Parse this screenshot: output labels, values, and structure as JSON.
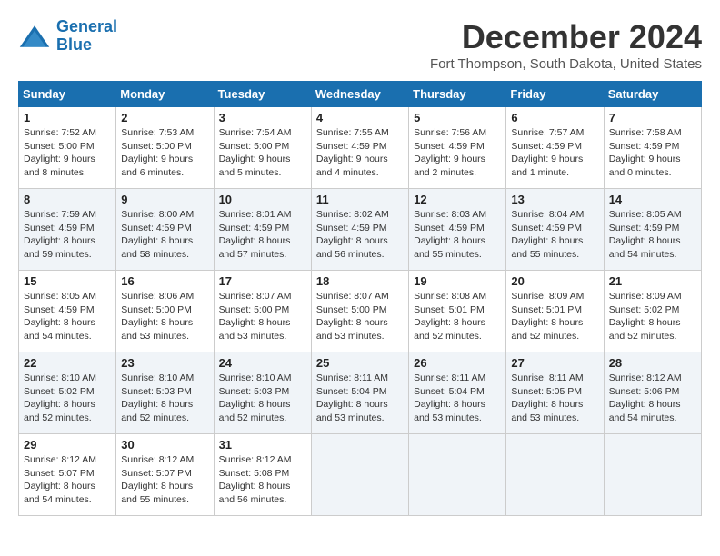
{
  "logo": {
    "line1": "General",
    "line2": "Blue"
  },
  "title": "December 2024",
  "location": "Fort Thompson, South Dakota, United States",
  "days_of_week": [
    "Sunday",
    "Monday",
    "Tuesday",
    "Wednesday",
    "Thursday",
    "Friday",
    "Saturday"
  ],
  "weeks": [
    [
      {
        "day": "1",
        "info": "Sunrise: 7:52 AM\nSunset: 5:00 PM\nDaylight: 9 hours\nand 8 minutes."
      },
      {
        "day": "2",
        "info": "Sunrise: 7:53 AM\nSunset: 5:00 PM\nDaylight: 9 hours\nand 6 minutes."
      },
      {
        "day": "3",
        "info": "Sunrise: 7:54 AM\nSunset: 5:00 PM\nDaylight: 9 hours\nand 5 minutes."
      },
      {
        "day": "4",
        "info": "Sunrise: 7:55 AM\nSunset: 4:59 PM\nDaylight: 9 hours\nand 4 minutes."
      },
      {
        "day": "5",
        "info": "Sunrise: 7:56 AM\nSunset: 4:59 PM\nDaylight: 9 hours\nand 2 minutes."
      },
      {
        "day": "6",
        "info": "Sunrise: 7:57 AM\nSunset: 4:59 PM\nDaylight: 9 hours\nand 1 minute."
      },
      {
        "day": "7",
        "info": "Sunrise: 7:58 AM\nSunset: 4:59 PM\nDaylight: 9 hours\nand 0 minutes."
      }
    ],
    [
      {
        "day": "8",
        "info": "Sunrise: 7:59 AM\nSunset: 4:59 PM\nDaylight: 8 hours\nand 59 minutes."
      },
      {
        "day": "9",
        "info": "Sunrise: 8:00 AM\nSunset: 4:59 PM\nDaylight: 8 hours\nand 58 minutes."
      },
      {
        "day": "10",
        "info": "Sunrise: 8:01 AM\nSunset: 4:59 PM\nDaylight: 8 hours\nand 57 minutes."
      },
      {
        "day": "11",
        "info": "Sunrise: 8:02 AM\nSunset: 4:59 PM\nDaylight: 8 hours\nand 56 minutes."
      },
      {
        "day": "12",
        "info": "Sunrise: 8:03 AM\nSunset: 4:59 PM\nDaylight: 8 hours\nand 55 minutes."
      },
      {
        "day": "13",
        "info": "Sunrise: 8:04 AM\nSunset: 4:59 PM\nDaylight: 8 hours\nand 55 minutes."
      },
      {
        "day": "14",
        "info": "Sunrise: 8:05 AM\nSunset: 4:59 PM\nDaylight: 8 hours\nand 54 minutes."
      }
    ],
    [
      {
        "day": "15",
        "info": "Sunrise: 8:05 AM\nSunset: 4:59 PM\nDaylight: 8 hours\nand 54 minutes."
      },
      {
        "day": "16",
        "info": "Sunrise: 8:06 AM\nSunset: 5:00 PM\nDaylight: 8 hours\nand 53 minutes."
      },
      {
        "day": "17",
        "info": "Sunrise: 8:07 AM\nSunset: 5:00 PM\nDaylight: 8 hours\nand 53 minutes."
      },
      {
        "day": "18",
        "info": "Sunrise: 8:07 AM\nSunset: 5:00 PM\nDaylight: 8 hours\nand 53 minutes."
      },
      {
        "day": "19",
        "info": "Sunrise: 8:08 AM\nSunset: 5:01 PM\nDaylight: 8 hours\nand 52 minutes."
      },
      {
        "day": "20",
        "info": "Sunrise: 8:09 AM\nSunset: 5:01 PM\nDaylight: 8 hours\nand 52 minutes."
      },
      {
        "day": "21",
        "info": "Sunrise: 8:09 AM\nSunset: 5:02 PM\nDaylight: 8 hours\nand 52 minutes."
      }
    ],
    [
      {
        "day": "22",
        "info": "Sunrise: 8:10 AM\nSunset: 5:02 PM\nDaylight: 8 hours\nand 52 minutes."
      },
      {
        "day": "23",
        "info": "Sunrise: 8:10 AM\nSunset: 5:03 PM\nDaylight: 8 hours\nand 52 minutes."
      },
      {
        "day": "24",
        "info": "Sunrise: 8:10 AM\nSunset: 5:03 PM\nDaylight: 8 hours\nand 52 minutes."
      },
      {
        "day": "25",
        "info": "Sunrise: 8:11 AM\nSunset: 5:04 PM\nDaylight: 8 hours\nand 53 minutes."
      },
      {
        "day": "26",
        "info": "Sunrise: 8:11 AM\nSunset: 5:04 PM\nDaylight: 8 hours\nand 53 minutes."
      },
      {
        "day": "27",
        "info": "Sunrise: 8:11 AM\nSunset: 5:05 PM\nDaylight: 8 hours\nand 53 minutes."
      },
      {
        "day": "28",
        "info": "Sunrise: 8:12 AM\nSunset: 5:06 PM\nDaylight: 8 hours\nand 54 minutes."
      }
    ],
    [
      {
        "day": "29",
        "info": "Sunrise: 8:12 AM\nSunset: 5:07 PM\nDaylight: 8 hours\nand 54 minutes."
      },
      {
        "day": "30",
        "info": "Sunrise: 8:12 AM\nSunset: 5:07 PM\nDaylight: 8 hours\nand 55 minutes."
      },
      {
        "day": "31",
        "info": "Sunrise: 8:12 AM\nSunset: 5:08 PM\nDaylight: 8 hours\nand 56 minutes."
      },
      {
        "day": "",
        "info": ""
      },
      {
        "day": "",
        "info": ""
      },
      {
        "day": "",
        "info": ""
      },
      {
        "day": "",
        "info": ""
      }
    ]
  ]
}
